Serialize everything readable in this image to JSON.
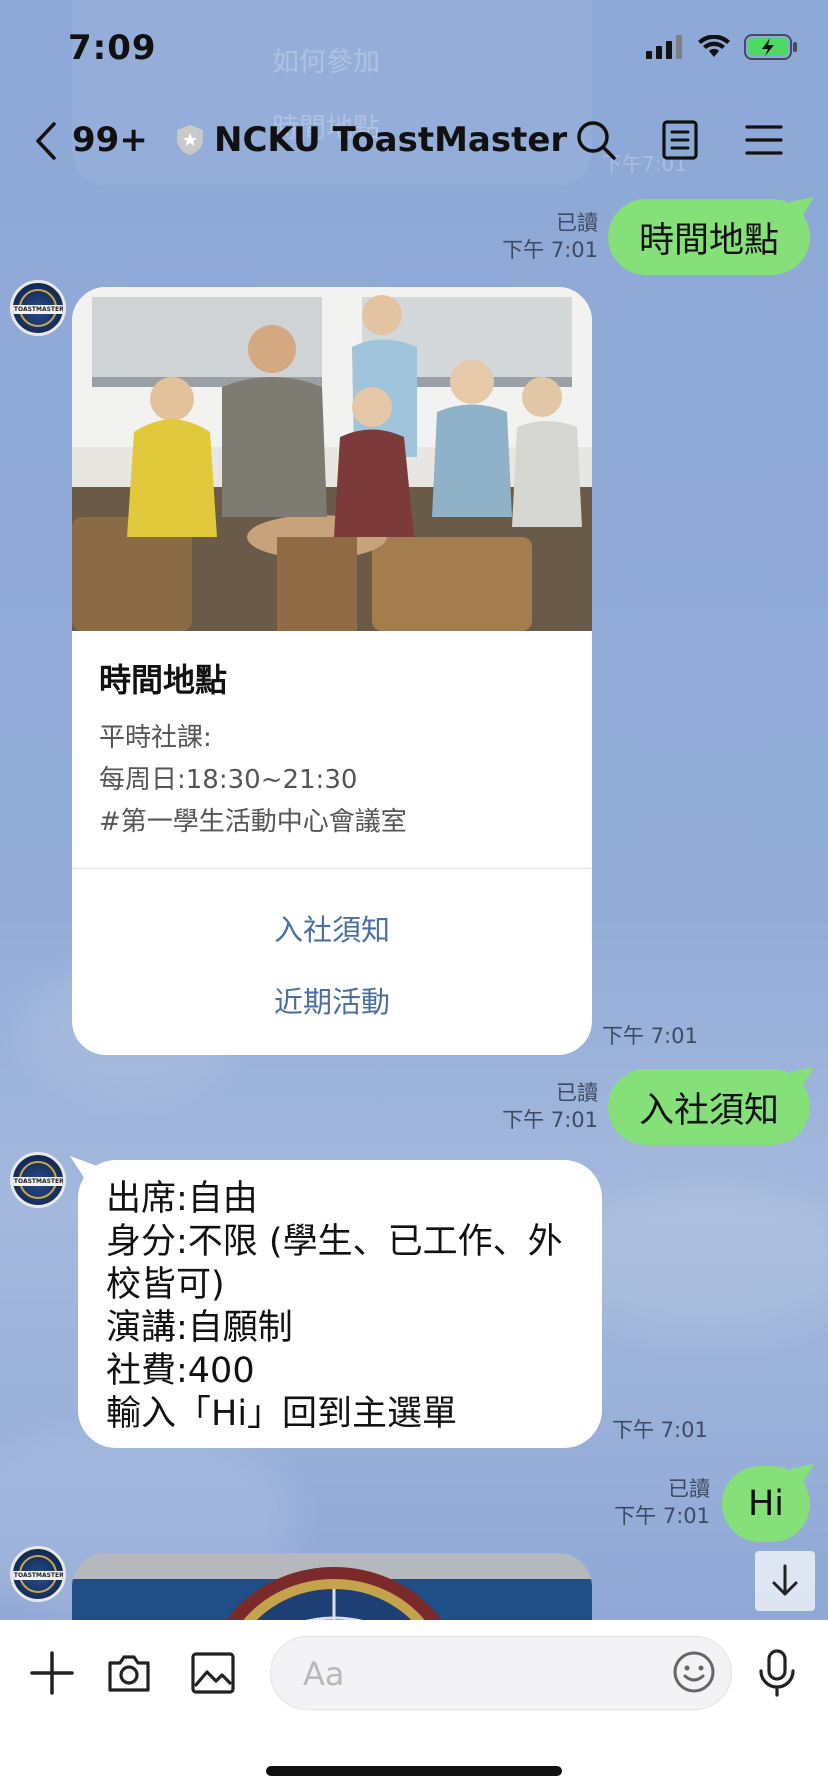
{
  "status_bar": {
    "time": "7:09",
    "icons": [
      "signal-icon",
      "wifi-icon",
      "battery-charging-icon"
    ]
  },
  "ghost": {
    "line1": "如何參加",
    "line2": "時間地點",
    "time": "下午7:01"
  },
  "header": {
    "unread_count": "99+",
    "title": "NCKU ToastMaster",
    "icons": [
      "back-chevron-icon",
      "shield-icon",
      "search-icon",
      "notes-icon",
      "menu-icon"
    ]
  },
  "messages": [
    {
      "type": "sent",
      "text": "時間地點",
      "read": "已讀",
      "time": "下午 7:01"
    },
    {
      "type": "flex-card",
      "title": "時間地點",
      "lines": [
        "平時社課:",
        "每周日:18:30~21:30",
        "#第一學生活動中心會議室"
      ],
      "buttons": [
        "入社須知",
        "近期活動"
      ],
      "time": "下午 7:01"
    },
    {
      "type": "sent",
      "text": "入社須知",
      "read": "已讀",
      "time": "下午 7:01"
    },
    {
      "type": "received",
      "lines": [
        "出席:自由",
        "身分:不限 (學生、已工作、外",
        "校皆可)",
        "演講:自願制",
        "社費:400",
        "輸入「Hi」回到主選單"
      ],
      "time": "下午 7:01"
    },
    {
      "type": "sent",
      "text": "Hi",
      "read": "已讀",
      "time": "下午 7:01"
    }
  ],
  "avatar_label": "TOASTMASTERS",
  "composer": {
    "placeholder": "Aa",
    "icons": [
      "plus-icon",
      "camera-icon",
      "image-icon",
      "emoji-icon",
      "microphone-icon"
    ]
  },
  "colors": {
    "chat_bg": "#8fa9d6",
    "sent_bubble": "#85e07a",
    "link": "#4a6fa0"
  }
}
